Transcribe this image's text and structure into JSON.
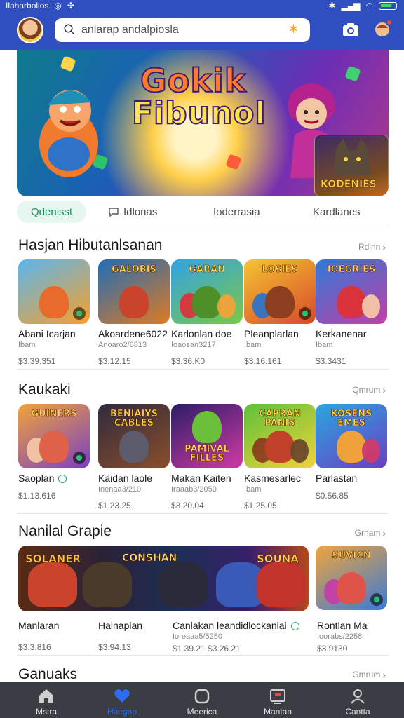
{
  "status": {
    "carrier": "Ilaharbolios"
  },
  "search": {
    "placeholder": "anlarap andalpiosla"
  },
  "hero": {
    "title_line1": "Gokik",
    "title_line2": "Fibunol",
    "inset_label": "KODENIES"
  },
  "tabs": [
    {
      "label": "Qdenisst",
      "active": true
    },
    {
      "label": "Idlonas",
      "active": false
    },
    {
      "label": "Ioderrasia",
      "active": false
    },
    {
      "label": "Kardlanes",
      "active": false
    }
  ],
  "sections": [
    {
      "title": "Hasjan Hibutanlsanan",
      "see_all": "Rdinn",
      "cards": [
        {
          "title": "Abani Icarjan",
          "sub": "Ibam",
          "price": "$3.39.351",
          "art": "",
          "c1": "#f6a02a",
          "c2": "#5ab6f0",
          "fig": "#e86b2c"
        },
        {
          "title": "Akoardene6022",
          "sub": "Anoaro2/6813",
          "price": "$3.12.15",
          "art": "GALOBIS",
          "c1": "#1e6db8",
          "c2": "#e07a21",
          "fig": "#c9442b"
        },
        {
          "title": "Karlonlan doe",
          "sub": "Ioaosan3217",
          "price": "$3.36.K0",
          "art": "GARAN",
          "c1": "#31a2e8",
          "c2": "#7ac943",
          "fig": "#4f8f2a"
        },
        {
          "title": "Pleanplarlan",
          "sub": "Ibam",
          "price": "$3.16.161",
          "art": "LOSIES",
          "c1": "#f5c531",
          "c2": "#d7482a",
          "fig": "#8b3f1e"
        },
        {
          "title": "Kerkanenar",
          "sub": "Ibam",
          "price": "$3.3431",
          "art": "IOEGRIES",
          "c1": "#2e7ad8",
          "c2": "#c33ea6",
          "fig": "#d9343c"
        }
      ]
    },
    {
      "title": "Kaukaki",
      "see_all": "Qmrum",
      "cards": [
        {
          "title": "Saoplan",
          "sub": "",
          "price": "$1.13.616",
          "art": "GUINERS",
          "c1": "#f0a338",
          "c2": "#7b3fc4",
          "fig": "#e0614a"
        },
        {
          "title": "Kaidan laole",
          "sub": "Inenaa3/210",
          "price": "$1.23.25",
          "art": "BENIAIYS CABLES",
          "c1": "#2f2a3f",
          "c2": "#8a4f2a",
          "fig": "#5b5b6b"
        },
        {
          "title": "Makan Kaiten",
          "sub": "Iraaab3/2050",
          "price": "$3.20.04",
          "art": "PAMIVAL FILLES",
          "c1": "#2b1d66",
          "c2": "#d23aa6",
          "fig": "#6bbf3a"
        },
        {
          "title": "Kasmesarlec",
          "sub": "Ibam",
          "price": "$1.25.05",
          "art": "CAPRAN PANIS",
          "c1": "#5cc13a",
          "c2": "#f4d23a",
          "fig": "#c0402a"
        },
        {
          "title": "Parlastan",
          "sub": "",
          "price": "$0.56.85",
          "art": "KOSENS EMES",
          "c1": "#2aa6e0",
          "c2": "#6a3fc4",
          "fig": "#f0a23a"
        }
      ]
    },
    {
      "title": "Nanilal Grapie",
      "see_all": "Grnam",
      "wide": {
        "art1": "SOLANER",
        "art2": "CONSHAN",
        "art3": "SOUNA"
      },
      "cards": [
        {
          "title": "Manlaran",
          "sub": "",
          "price": "$3.3.816"
        },
        {
          "title": "Halnapian",
          "sub": "",
          "price": "$3.94.13"
        },
        {
          "title": "Canlakan leandidlockanlai",
          "sub": "Ioreaaa5/5250",
          "price": "$1.39.21  $3.26.21"
        },
        {
          "title": "Rontlan Ma",
          "sub": "Ioorabs/2258",
          "price": "$3.9130",
          "art": "SUVICN",
          "c1": "#f0a43a",
          "c2": "#3a7ad8",
          "fig": "#e0534a"
        }
      ]
    },
    {
      "title": "Ganuaks",
      "see_all": "Gmrum"
    }
  ],
  "nav": [
    {
      "label": "Mstra",
      "icon": "home-icon",
      "active": false
    },
    {
      "label": "Haegap",
      "icon": "heart-icon",
      "active": true
    },
    {
      "label": "Meerica",
      "icon": "box-icon",
      "active": false
    },
    {
      "label": "Mantan",
      "icon": "tablet-icon",
      "active": false
    },
    {
      "label": "Cantta",
      "icon": "profile-icon",
      "active": false
    }
  ]
}
